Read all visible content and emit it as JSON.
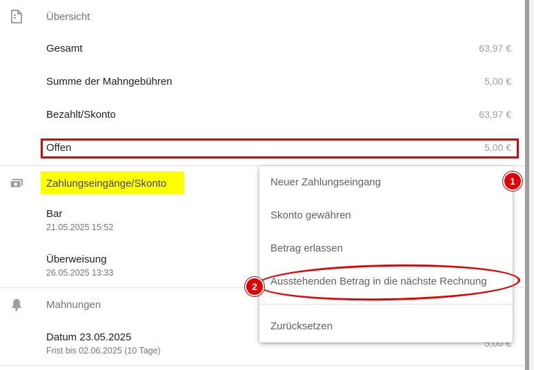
{
  "overview": {
    "title": "Übersicht",
    "icon": "document-icon",
    "rows": [
      {
        "label": "Gesamt",
        "value": "63,97 €"
      },
      {
        "label": "Summe der Mahngebühren",
        "value": "5,00 €"
      },
      {
        "label": "Bezahlt/Skonto",
        "value": "63,97 €"
      },
      {
        "label": "Offen",
        "value": "5,00 €"
      }
    ]
  },
  "payments": {
    "title": "Zahlungseingänge/Skonto",
    "icon": "cash-icon",
    "rows": [
      {
        "label": "Bar",
        "sub": "21.05.2025 15:52"
      },
      {
        "label": "Überweisung",
        "sub": "26.05.2025 13:33"
      }
    ]
  },
  "reminders": {
    "title": "Mahnungen",
    "icon": "bell-icon",
    "rows": [
      {
        "label": "Datum 23.05.2025",
        "sub": "Frist bis 02.06.2025 (10 Tage)",
        "value": "5,00 €"
      }
    ]
  },
  "menu": {
    "items": [
      {
        "label": "Neuer Zahlungseingang"
      },
      {
        "label": "Skonto gewähren"
      },
      {
        "label": "Betrag erlassen"
      },
      {
        "label": "Ausstehenden Betrag in die nächste Rechnung"
      },
      {
        "label": "Zurücksetzen"
      }
    ]
  },
  "annotations": {
    "badge1": "1",
    "badge2": "2",
    "color": "#e00000",
    "highlight": "#ffff00"
  }
}
